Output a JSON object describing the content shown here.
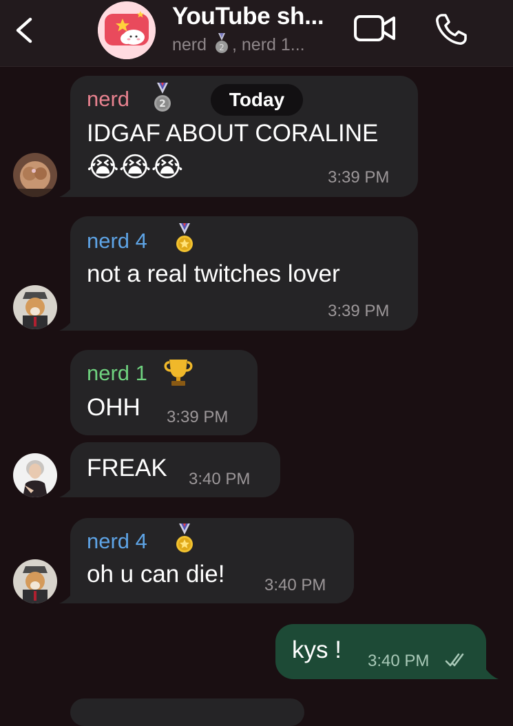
{
  "header": {
    "back_icon": "chevron-left-icon",
    "group_avatar_icon": "youtube-star-cloud-avatar",
    "title": "YouTube sh...",
    "subtitle_part1": "nerd",
    "subtitle_part2": ", nerd 1...",
    "video_icon": "video-camera-icon",
    "call_icon": "phone-icon"
  },
  "date_label": "Today",
  "messages": [
    {
      "sender": "nerd",
      "sender_color": "#e8828f",
      "medal": "silver-medal-2",
      "text": "IDGAF ABOUT CORALINE",
      "emoji": "😭😭😭",
      "time": "3:39 PM"
    },
    {
      "sender": "nerd 4",
      "sender_color": "#5ea4e6",
      "medal": "gold-medal",
      "text": "not a real twitches lover",
      "time": "3:39 PM"
    },
    {
      "sender": "nerd 1",
      "sender_color": "#6fd27f",
      "medal": "trophy",
      "text": "OHH",
      "time": "3:39 PM"
    },
    {
      "text": "FREAK",
      "time": "3:40 PM"
    },
    {
      "sender": "nerd 4",
      "sender_color": "#5ea4e6",
      "medal": "gold-medal",
      "text": "oh u can die!",
      "time": "3:40 PM"
    }
  ],
  "outgoing": {
    "text": "kys !",
    "time": "3:40 PM",
    "status_icon": "double-check-icon"
  },
  "colors": {
    "background": "#1a0f12",
    "header": "#221a1d",
    "incoming_bubble": "#252426",
    "outgoing_bubble": "#1d4a36"
  }
}
